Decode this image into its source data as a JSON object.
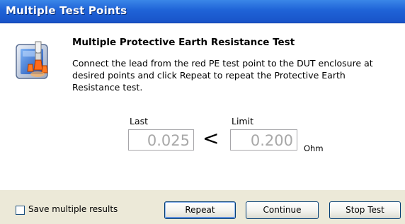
{
  "window": {
    "title": "Multiple Test Points"
  },
  "dialog": {
    "heading": "Multiple Protective Earth Resistance Test",
    "instructions": "Connect the lead from the red PE test point to the DUT enclosure at\ndesired points and click Repeat to repeat the Protective Earth\nResistance test.",
    "icon": "test-probe-icon"
  },
  "measurement": {
    "last_label": "Last",
    "last_value": "0.025",
    "comparator": "<",
    "limit_label": "Limit",
    "limit_value": "0.200",
    "unit": "Ohm"
  },
  "footer": {
    "save_multiple_label": "Save multiple results",
    "save_multiple_checked": false,
    "buttons": {
      "repeat": "Repeat",
      "continue": "Continue",
      "stop": "Stop Test"
    }
  },
  "colors": {
    "titlebar": "#1f63d7",
    "dialog_background": "#ece9d8",
    "content_background": "#ffffff",
    "value_text": "#a8a8a8"
  }
}
